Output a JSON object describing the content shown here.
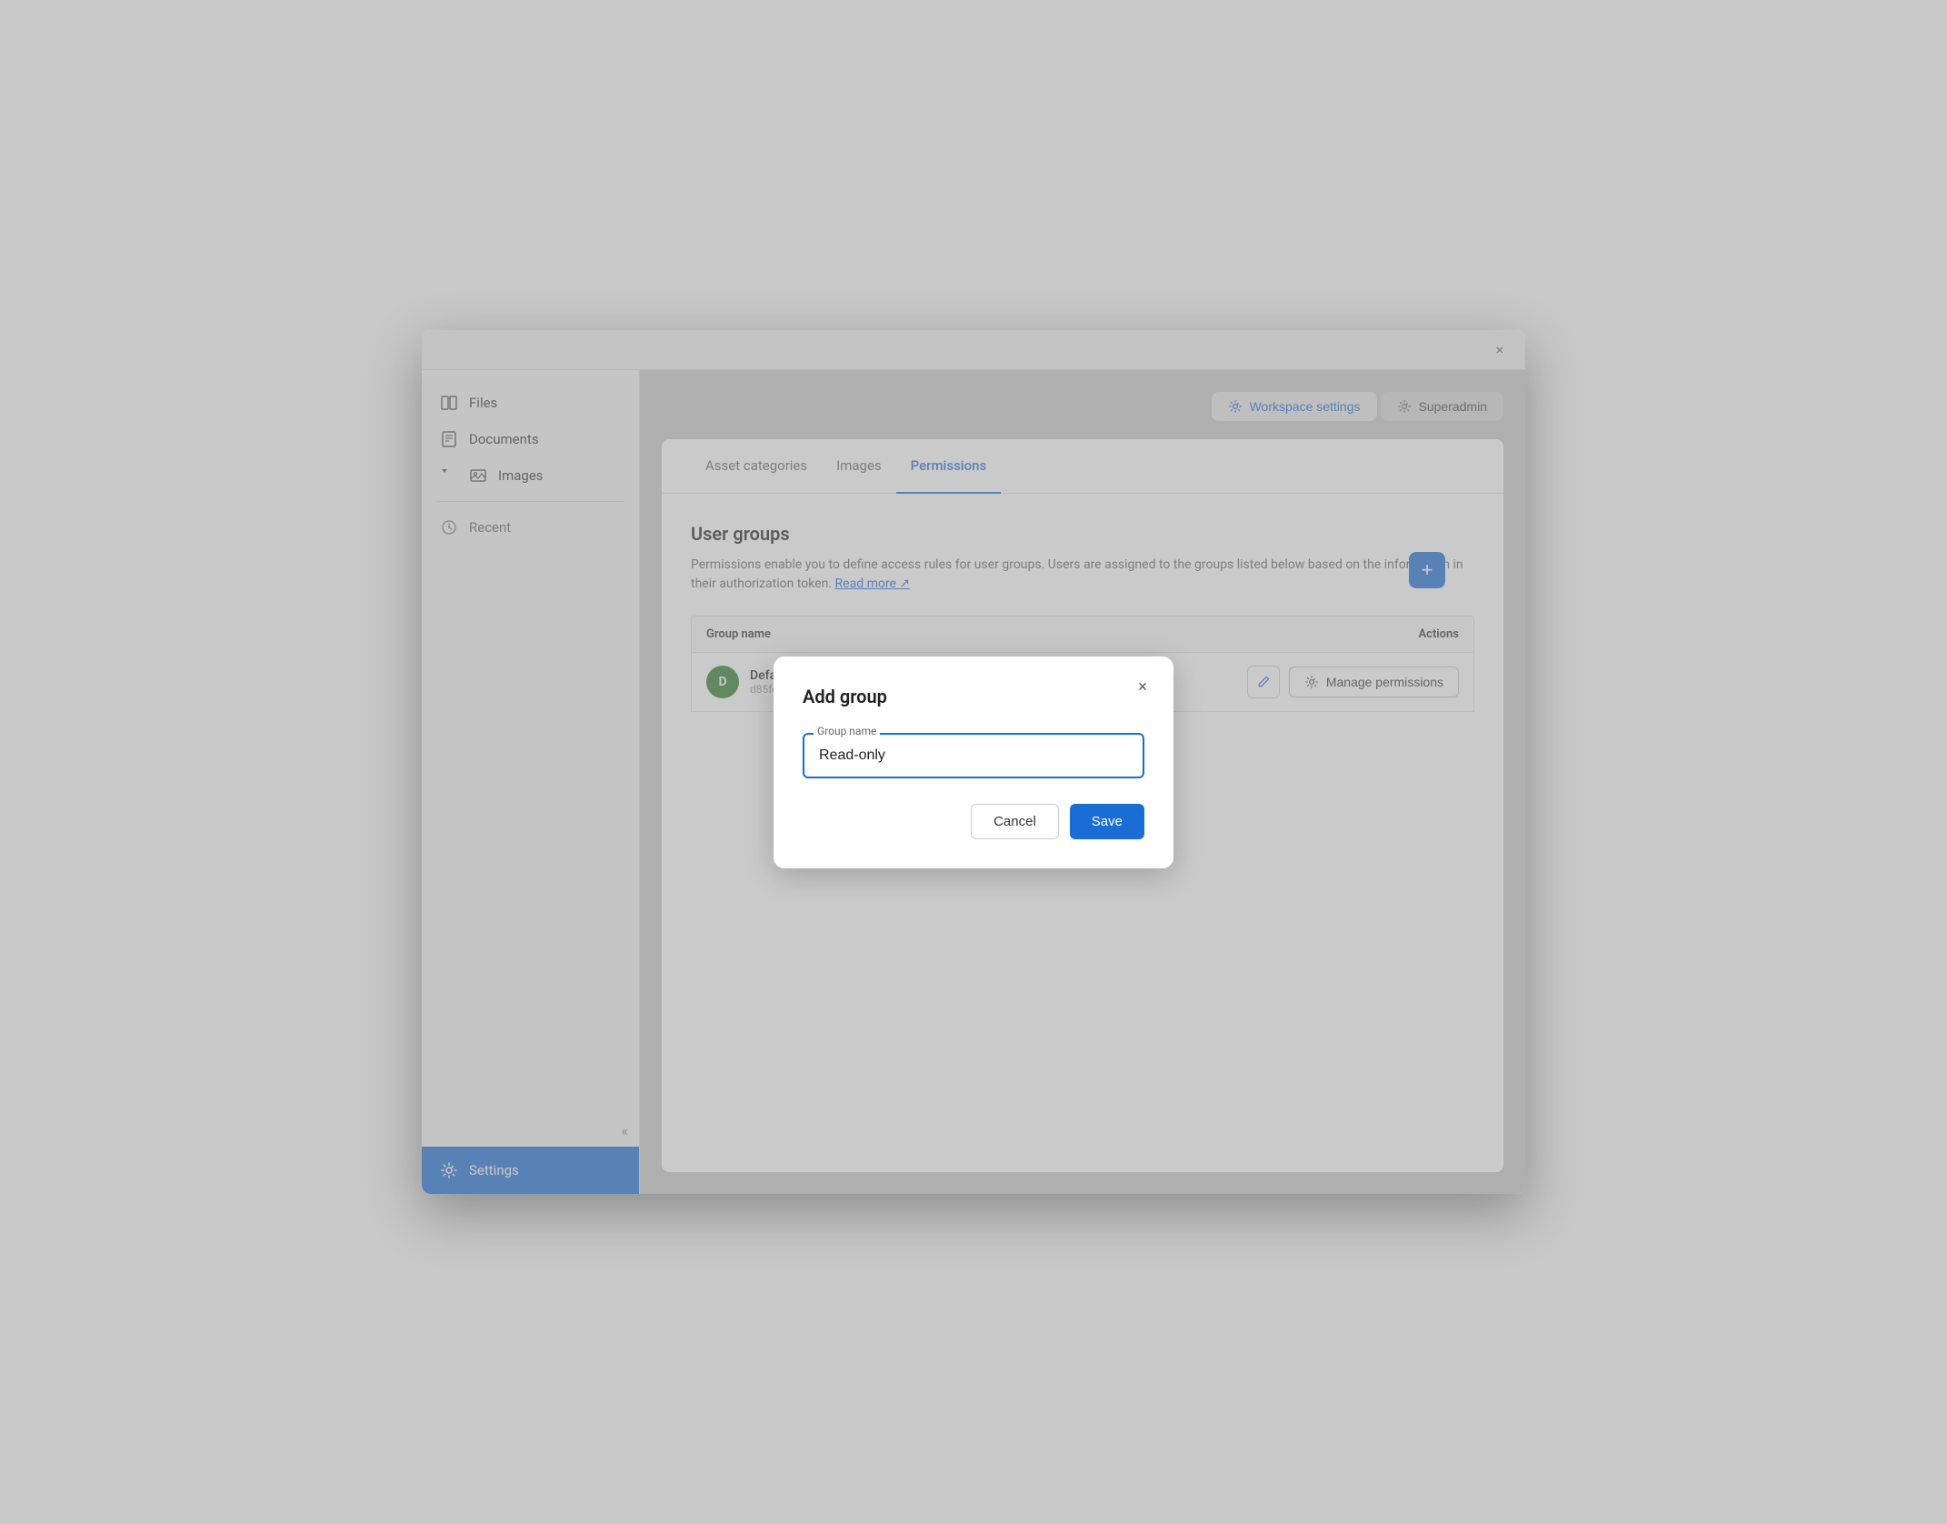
{
  "window": {
    "close_label": "×"
  },
  "sidebar": {
    "items": [
      {
        "id": "files",
        "label": "Files",
        "icon": "files-icon"
      },
      {
        "id": "documents",
        "label": "Documents",
        "icon": "documents-icon"
      },
      {
        "id": "images",
        "label": "Images",
        "icon": "images-icon"
      }
    ],
    "recent": {
      "label": "Recent",
      "icon": "recent-icon"
    },
    "collapse_icon": "«",
    "settings_label": "Settings"
  },
  "topbar": {
    "workspace_label": "Workspace settings",
    "superadmin_label": "Superadmin"
  },
  "tabs": [
    {
      "id": "asset-categories",
      "label": "Asset categories"
    },
    {
      "id": "images",
      "label": "Images"
    },
    {
      "id": "permissions",
      "label": "Permissions"
    }
  ],
  "active_tab": "permissions",
  "permissions": {
    "section_title": "User groups",
    "section_desc": "Permissions enable you to define access rules for user groups. Users are assigned to the groups listed below based on the information in their authorization token.",
    "read_more_label": "Read more",
    "add_button_label": "+",
    "table": {
      "col_group_name": "Group name",
      "col_actions": "Actions",
      "rows": [
        {
          "avatar_letter": "D",
          "avatar_color": "#2d7a2d",
          "name": "Defa...",
          "id": "d85fe5..."
        }
      ]
    },
    "manage_permissions_label": "Manage permissions"
  },
  "modal": {
    "title": "Add group",
    "group_name_label": "Group name",
    "group_name_value": "Read-only",
    "cancel_label": "Cancel",
    "save_label": "Save"
  }
}
